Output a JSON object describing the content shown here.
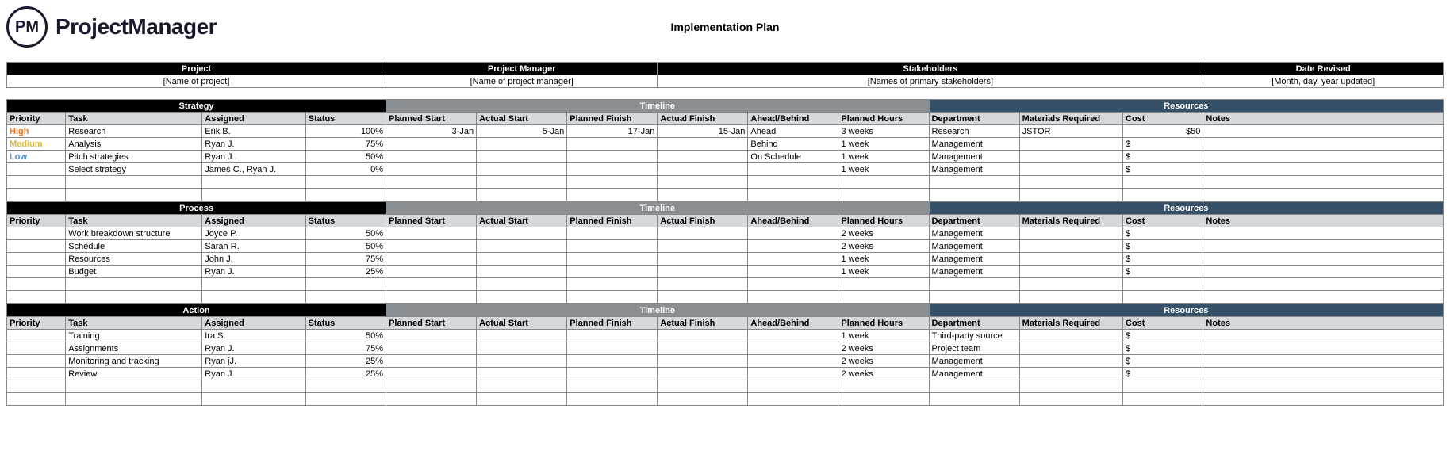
{
  "brand": {
    "logo_initials": "PM",
    "logo_text": "ProjectManager"
  },
  "doc_title": "Implementation Plan",
  "topmeta": {
    "headers": [
      "Project",
      "Project Manager",
      "Stakeholders",
      "Date Revised"
    ],
    "values": [
      "[Name of project]",
      "[Name of project manager]",
      "[Names of primary stakeholders]",
      "[Month, day, year updated]"
    ]
  },
  "band_labels": {
    "timeline": "Timeline",
    "resources": "Resources"
  },
  "colheads": {
    "priority": "Priority",
    "task": "Task",
    "assigned": "Assigned",
    "status": "Status",
    "planned_start": "Planned Start",
    "actual_start": "Actual Start",
    "planned_finish": "Planned Finish",
    "actual_finish": "Actual Finish",
    "ahead_behind": "Ahead/Behind",
    "planned_hours": "Planned Hours",
    "department": "Department",
    "materials": "Materials Required",
    "cost": "Cost",
    "notes": "Notes"
  },
  "sections": [
    {
      "name": "Strategy",
      "rows": [
        {
          "priority": "High",
          "priority_class": "priority-high",
          "task": "Research",
          "assigned": "Erik B.",
          "status": "100%",
          "planned_start": "3-Jan",
          "actual_start": "5-Jan",
          "planned_finish": "17-Jan",
          "actual_finish": "15-Jan",
          "ahead_behind": "Ahead",
          "planned_hours": "3 weeks",
          "department": "Research",
          "materials": "JSTOR",
          "cost": "$50",
          "notes": ""
        },
        {
          "priority": "Medium",
          "priority_class": "priority-medium",
          "task": "Analysis",
          "assigned": "Ryan J.",
          "status": "75%",
          "planned_start": "",
          "actual_start": "",
          "planned_finish": "",
          "actual_finish": "",
          "ahead_behind": "Behind",
          "planned_hours": "1 week",
          "department": "Management",
          "materials": "",
          "cost": "$",
          "notes": ""
        },
        {
          "priority": "Low",
          "priority_class": "priority-low",
          "task": "Pitch strategies",
          "assigned": "Ryan J..",
          "status": "50%",
          "planned_start": "",
          "actual_start": "",
          "planned_finish": "",
          "actual_finish": "",
          "ahead_behind": "On Schedule",
          "planned_hours": "1 week",
          "department": "Management",
          "materials": "",
          "cost": "$",
          "notes": ""
        },
        {
          "priority": "",
          "priority_class": "",
          "task": "Select strategy",
          "assigned": "James C., Ryan J.",
          "status": "0%",
          "planned_start": "",
          "actual_start": "",
          "planned_finish": "",
          "actual_finish": "",
          "ahead_behind": "",
          "planned_hours": "1 week",
          "department": "Management",
          "materials": "",
          "cost": "$",
          "notes": ""
        }
      ]
    },
    {
      "name": "Process",
      "rows": [
        {
          "priority": "",
          "priority_class": "",
          "task": "Work breakdown structure",
          "assigned": "Joyce P.",
          "status": "50%",
          "planned_start": "",
          "actual_start": "",
          "planned_finish": "",
          "actual_finish": "",
          "ahead_behind": "",
          "planned_hours": "2 weeks",
          "department": "Management",
          "materials": "",
          "cost": "$",
          "notes": ""
        },
        {
          "priority": "",
          "priority_class": "",
          "task": "Schedule",
          "assigned": "Sarah R.",
          "status": "50%",
          "planned_start": "",
          "actual_start": "",
          "planned_finish": "",
          "actual_finish": "",
          "ahead_behind": "",
          "planned_hours": "2 weeks",
          "department": "Management",
          "materials": "",
          "cost": "$",
          "notes": ""
        },
        {
          "priority": "",
          "priority_class": "",
          "task": "Resources",
          "assigned": "John J.",
          "status": "75%",
          "planned_start": "",
          "actual_start": "",
          "planned_finish": "",
          "actual_finish": "",
          "ahead_behind": "",
          "planned_hours": "1 week",
          "department": "Management",
          "materials": "",
          "cost": "$",
          "notes": ""
        },
        {
          "priority": "",
          "priority_class": "",
          "task": "Budget",
          "assigned": "Ryan J.",
          "status": "25%",
          "planned_start": "",
          "actual_start": "",
          "planned_finish": "",
          "actual_finish": "",
          "ahead_behind": "",
          "planned_hours": "1 week",
          "department": "Management",
          "materials": "",
          "cost": "$",
          "notes": ""
        }
      ]
    },
    {
      "name": "Action",
      "rows": [
        {
          "priority": "",
          "priority_class": "",
          "task": "Training",
          "assigned": "Ira S.",
          "status": "50%",
          "planned_start": "",
          "actual_start": "",
          "planned_finish": "",
          "actual_finish": "",
          "ahead_behind": "",
          "planned_hours": "1 week",
          "department": "Third-party source",
          "materials": "",
          "cost": "$",
          "notes": ""
        },
        {
          "priority": "",
          "priority_class": "",
          "task": "Assignments",
          "assigned": "Ryan J.",
          "status": "75%",
          "planned_start": "",
          "actual_start": "",
          "planned_finish": "",
          "actual_finish": "",
          "ahead_behind": "",
          "planned_hours": "2 weeks",
          "department": "Project team",
          "materials": "",
          "cost": "$",
          "notes": ""
        },
        {
          "priority": "",
          "priority_class": "",
          "task": "Monitoring and tracking",
          "assigned": "Ryan jJ.",
          "status": "25%",
          "planned_start": "",
          "actual_start": "",
          "planned_finish": "",
          "actual_finish": "",
          "ahead_behind": "",
          "planned_hours": "2 weeks",
          "department": "Management",
          "materials": "",
          "cost": "$",
          "notes": ""
        },
        {
          "priority": "",
          "priority_class": "",
          "task": "Review",
          "assigned": "Ryan J.",
          "status": "25%",
          "planned_start": "",
          "actual_start": "",
          "planned_finish": "",
          "actual_finish": "",
          "ahead_behind": "",
          "planned_hours": "2 weeks",
          "department": "Management",
          "materials": "",
          "cost": "$",
          "notes": ""
        }
      ]
    }
  ]
}
